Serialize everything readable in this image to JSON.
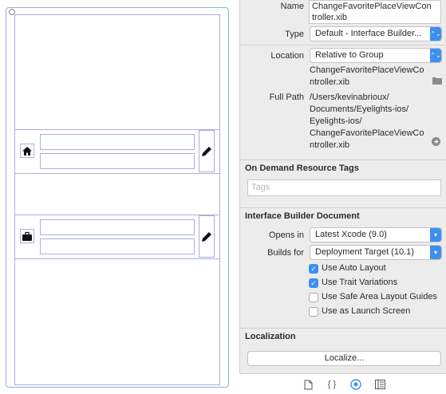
{
  "inspector": {
    "name_label": "Name",
    "name_value_line1": "ChangeFavoritePlaceViewCon",
    "name_value_line2": "troller.xib",
    "type_label": "Type",
    "type_value": "Default - Interface Builder...",
    "location_label": "Location",
    "location_value": "Relative to Group",
    "location_path_line1": "ChangeFavoritePlaceViewCo",
    "location_path_line2": "ntroller.xib",
    "fullpath_label": "Full Path",
    "fullpath_lines": [
      "/Users/kevinabrioux/",
      "Documents/Eyelights-ios/",
      "Eyelights-ios/",
      "ChangeFavoritePlaceViewCo",
      "ntroller.xib"
    ],
    "odr_title": "On Demand Resource Tags",
    "tags_placeholder": "Tags",
    "ibd_title": "Interface Builder Document",
    "opens_in_label": "Opens in",
    "opens_in_value": "Latest Xcode (9.0)",
    "builds_for_label": "Builds for",
    "builds_for_value": "Deployment Target (10.1)",
    "checkboxes": [
      {
        "label": "Use Auto Layout",
        "checked": true
      },
      {
        "label": "Use Trait Variations",
        "checked": true
      },
      {
        "label": "Use Safe Area Layout Guides",
        "checked": false
      },
      {
        "label": "Use as Launch Screen",
        "checked": false
      }
    ],
    "localization_title": "Localization",
    "localize_button": "Localize...",
    "check_glyph": "✓",
    "popup_arrows": "⌃⌄"
  },
  "toolbar_icons": [
    "file-icon",
    "braces-icon",
    "target-icon",
    "library-icon"
  ]
}
